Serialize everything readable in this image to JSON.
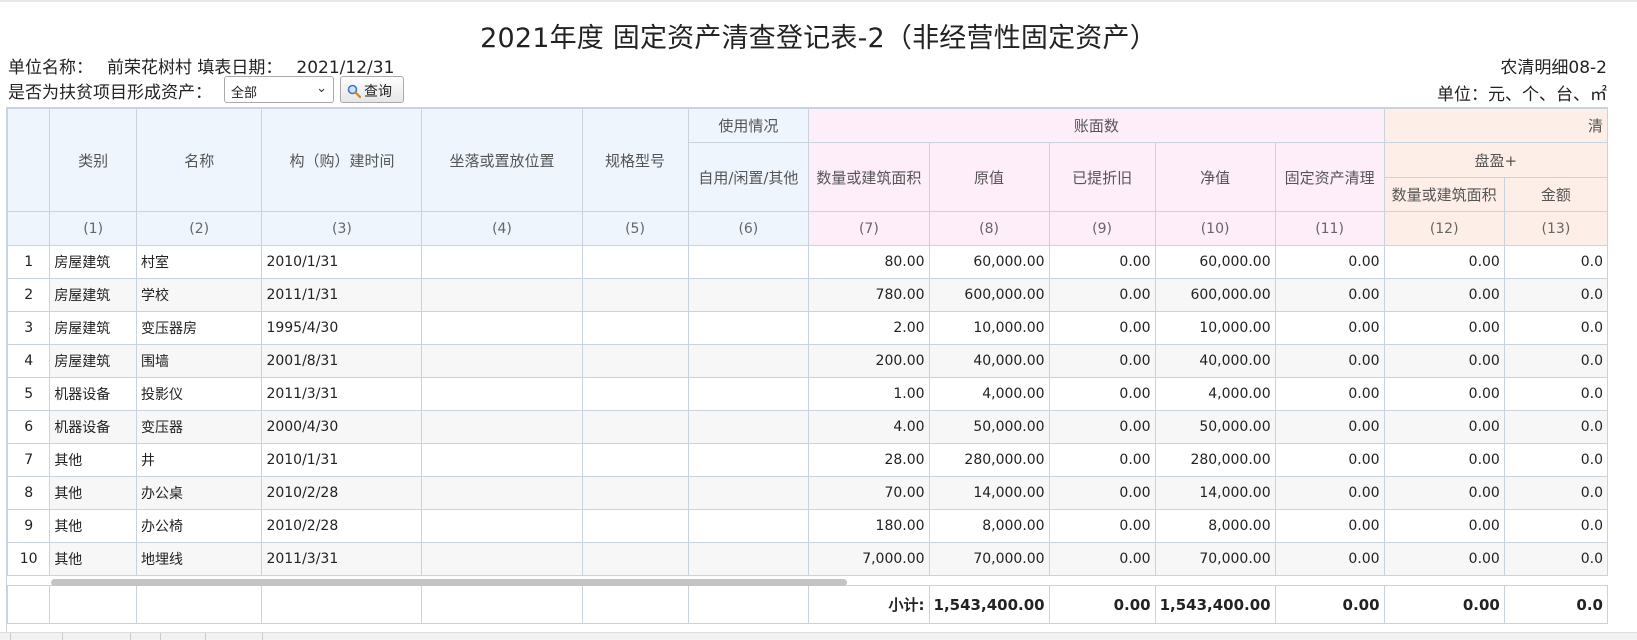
{
  "title": "2021年度 固定资产清查登记表-2（非经营性固定资产）",
  "unit_label": "单位名称：",
  "unit_value": "前荣花树村",
  "date_label": "填表日期：",
  "date_value": "2021/12/31",
  "form_code": "农清明细08-2",
  "units_note": "单位：元、个、台、㎡",
  "filter": {
    "label": "是否为扶贫项目形成资产：",
    "selected": "全部",
    "query_label": "查询"
  },
  "headers": {
    "category": "类别",
    "name": "名称",
    "build_time": "构（购）建时间",
    "location": "坐落或置放位置",
    "spec": "规格型号",
    "usage_group": "使用情况",
    "usage": "自用/闲置/其他",
    "book_group": "账面数",
    "quantity": "数量或建筑面积",
    "original": "原值",
    "depreciation": "已提折旧",
    "net": "净值",
    "cleanup": "固定资产清理",
    "check_group": "清",
    "surplus_group": "盘盈+",
    "surplus_qty": "数量或建筑面积",
    "surplus_amount": "金额"
  },
  "col_index": [
    "(1)",
    "(2)",
    "(3)",
    "(4)",
    "(5)",
    "(6)",
    "(7)",
    "(8)",
    "(9)",
    "(10)",
    "(11)",
    "(12)",
    "(13)"
  ],
  "rows": [
    {
      "no": "1",
      "category": "房屋建筑",
      "name": "村室",
      "time": "2010/1/31",
      "qty": "80.00",
      "orig": "60,000.00",
      "dep": "0.00",
      "net": "60,000.00",
      "clean": "0.00",
      "sq": "0.00",
      "sa": "0.0"
    },
    {
      "no": "2",
      "category": "房屋建筑",
      "name": "学校",
      "time": "2011/1/31",
      "qty": "780.00",
      "orig": "600,000.00",
      "dep": "0.00",
      "net": "600,000.00",
      "clean": "0.00",
      "sq": "0.00",
      "sa": "0.0"
    },
    {
      "no": "3",
      "category": "房屋建筑",
      "name": "变压器房",
      "time": "1995/4/30",
      "qty": "2.00",
      "orig": "10,000.00",
      "dep": "0.00",
      "net": "10,000.00",
      "clean": "0.00",
      "sq": "0.00",
      "sa": "0.0"
    },
    {
      "no": "4",
      "category": "房屋建筑",
      "name": "围墙",
      "time": "2001/8/31",
      "qty": "200.00",
      "orig": "40,000.00",
      "dep": "0.00",
      "net": "40,000.00",
      "clean": "0.00",
      "sq": "0.00",
      "sa": "0.0"
    },
    {
      "no": "5",
      "category": "机器设备",
      "name": "投影仪",
      "time": "2011/3/31",
      "qty": "1.00",
      "orig": "4,000.00",
      "dep": "0.00",
      "net": "4,000.00",
      "clean": "0.00",
      "sq": "0.00",
      "sa": "0.0"
    },
    {
      "no": "6",
      "category": "机器设备",
      "name": "变压器",
      "time": "2000/4/30",
      "qty": "4.00",
      "orig": "50,000.00",
      "dep": "0.00",
      "net": "50,000.00",
      "clean": "0.00",
      "sq": "0.00",
      "sa": "0.0"
    },
    {
      "no": "7",
      "category": "其他",
      "name": "井",
      "time": "2010/1/31",
      "qty": "28.00",
      "orig": "280,000.00",
      "dep": "0.00",
      "net": "280,000.00",
      "clean": "0.00",
      "sq": "0.00",
      "sa": "0.0"
    },
    {
      "no": "8",
      "category": "其他",
      "name": "办公桌",
      "time": "2010/2/28",
      "qty": "70.00",
      "orig": "14,000.00",
      "dep": "0.00",
      "net": "14,000.00",
      "clean": "0.00",
      "sq": "0.00",
      "sa": "0.0"
    },
    {
      "no": "9",
      "category": "其他",
      "name": "办公椅",
      "time": "2010/2/28",
      "qty": "180.00",
      "orig": "8,000.00",
      "dep": "0.00",
      "net": "8,000.00",
      "clean": "0.00",
      "sq": "0.00",
      "sa": "0.0"
    },
    {
      "no": "10",
      "category": "其他",
      "name": "地埋线",
      "time": "2011/3/31",
      "qty": "7,000.00",
      "orig": "70,000.00",
      "dep": "0.00",
      "net": "70,000.00",
      "clean": "0.00",
      "sq": "0.00",
      "sa": "0.0"
    }
  ],
  "subtotal": {
    "label": "小计:",
    "orig": "1,543,400.00",
    "dep": "0.00",
    "net": "1,543,400.00",
    "clean": "0.00",
    "sq": "0.00",
    "sa": "0.0"
  }
}
